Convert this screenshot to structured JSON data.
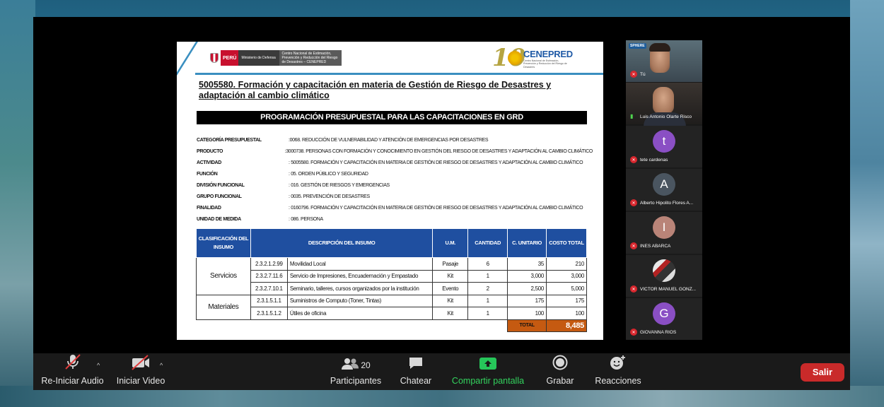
{
  "slide": {
    "header": {
      "peru_label": "PERÚ",
      "ministry_label": "Ministerio de Defensa",
      "center_label": "Centro Nacional de Estimación, Prevención y Reducción del Riesgo de Desastres – CENEPRED",
      "logo_number": "10",
      "logo_name": "CENEPRED",
      "logo_sub": "Centro Nacional de Estimación, Prevención y Reducción del Riesgo de Desastres"
    },
    "title": "5005580. Formación y capacitación en materia de Gestión de Riesgo de Desastres y adaptación al cambio climático",
    "banner": "PROGRAMACIÓN PRESUPUESTAL PARA LAS CAPACITACIONES EN GRD",
    "info": [
      {
        "key": "CATEGORÍA PRESUPUESTAL",
        "value": ":0068. REDUCCIÓN DE VULNERABILIDAD Y ATENCIÓN DE EMERGENCIAS POR DESASTRES"
      },
      {
        "key": "PRODUCTO",
        "value": ":3000738. PERSONAS CON FORMACIÓN Y CONOCIMIENTO EN GESTIÓN DEL RIESGO DE DESASTRES Y ADAPTACIÓN AL CAMBIO CLIMÁTICO"
      },
      {
        "key": "ACTIVIDAD",
        "value": ": 5005580. FORMACIÓN Y CAPACITACIÓN EN MATERIA DE GESTIÓN DE RIESGO DE DESASTRES Y ADAPTACIÓN AL CAMBIO CLIMÁTICO"
      },
      {
        "key": "FUNCIÓN",
        "value": ": 05. ORDEN PÚBLICO Y SEGURIDAD"
      },
      {
        "key": "DIVISIÓN FUNCIONAL",
        "value": ": 016. GESTIÓN DE RIESGOS Y EMERGENCIAS"
      },
      {
        "key": "GRUPO FUNCIONAL",
        "value": ": 0035. PREVENCIÓN DE DESASTRES"
      },
      {
        "key": "FINALIDAD",
        "value": ": 0160796. FORMACIÓN Y CAPACITACIÓN EN MATERIA DE GESTIÓN DE RIESGO DE DESASTRES Y ADAPTACIÓN AL CAMBIO CLIMÁTICO"
      },
      {
        "key": "UNIDAD DE MEDIDA",
        "value": ": 086. PERSONA"
      }
    ],
    "table": {
      "headers": [
        "CLASIFICACIÓN DEL INSUMO",
        "DESCRIPCIÓN DEL INSUMO",
        "U.M.",
        "CANTIDAD",
        "C. UNITARIO",
        "COSTO TOTAL"
      ],
      "groups": [
        "Servicios",
        "Materiales"
      ],
      "rows": [
        {
          "code": "2.3.2.1.2.99",
          "desc": "Movilidad Local",
          "um": "Pasaje",
          "qty": "6",
          "unit": "35",
          "total": "210"
        },
        {
          "code": "2.3.2.7.11.6",
          "desc": "Servicio de Impresiones, Encuadernación y Empastado",
          "um": "Kit",
          "qty": "1",
          "unit": "3,000",
          "total": "3,000"
        },
        {
          "code": "2.3.2.7.10.1",
          "desc": "Seminario, talleres, cursos organizados por la institución",
          "um": "Evento",
          "qty": "2",
          "unit": "2,500",
          "total": "5,000"
        },
        {
          "code": "2.3.1.5.1.1",
          "desc": "Suministros de Computo (Toner, Tintas)",
          "um": "Kit",
          "qty": "1",
          "unit": "175",
          "total": "175"
        },
        {
          "code": "2.3.1.5.1.2",
          "desc": "Útiles de oficina",
          "um": "Kit",
          "qty": "1",
          "unit": "100",
          "total": "100"
        }
      ],
      "total_label": "TOTAL",
      "total_value": "8,485"
    }
  },
  "participants_panel": {
    "tiles": [
      {
        "name": "Tú",
        "type": "video"
      },
      {
        "name": "Luis Antonio Olarte Risco",
        "type": "video"
      },
      {
        "name": "tete cardenas",
        "initial": "t",
        "color": "#8a4fc4"
      },
      {
        "name": "Alberto Hipolito Flores A...",
        "initial": "A",
        "color": "#4a5560"
      },
      {
        "name": "INES ABARCA",
        "initial": "I",
        "color": "#b98478"
      },
      {
        "name": "VÍCTOR MANUEL GONZ...",
        "initial": "",
        "color": "#666"
      },
      {
        "name": "GIOVANNA RIOS",
        "initial": "G",
        "color": "#8a4fc4"
      }
    ],
    "video_tag": "SPHERE"
  },
  "toolbar": {
    "audio_label": "Re-Iniciar Audio",
    "video_label": "Iniciar Video",
    "participants_label": "Participantes",
    "participants_count": "20",
    "chat_label": "Chatear",
    "share_label": "Compartir pantalla",
    "record_label": "Grabar",
    "reactions_label": "Reacciones",
    "leave_label": "Salir"
  },
  "colors": {
    "table_header": "#1f4fa0",
    "total_cell": "#c55a11",
    "share_green": "#33d35e",
    "leave_red": "#c92a2a"
  }
}
